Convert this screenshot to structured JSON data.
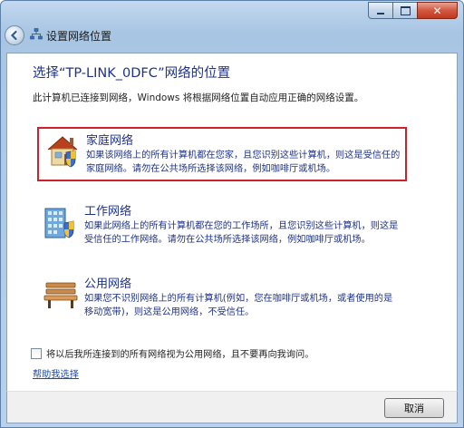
{
  "window": {
    "title": "设置网络位置",
    "close_glyph": "✕"
  },
  "content": {
    "heading": "选择“TP-LINK_0DFC”网络的位置",
    "description": "此计算机已连接到网络，Windows 将根据网络位置自动应用正确的网络设置。",
    "options": [
      {
        "title": "家庭网络",
        "desc": "如果该网络上的所有计算机都在您家，且您识别这些计算机，则这是受信任的家庭网络。请勿在公共场所选择该网络，例如咖啡厅或机场。",
        "icon": "home-icon",
        "selected": true
      },
      {
        "title": "工作网络",
        "desc": "如果此网络上的所有计算机都在您的工作场所，且您识别这些计算机，则这是受信任的工作网络。请勿在公共场所选择该网络，例如咖啡厅或机场。",
        "icon": "office-building-icon",
        "selected": false
      },
      {
        "title": "公用网络",
        "desc": "如果您不识别网络上的所有计算机(例如，您在咖啡厅或机场，或者使用的是移动宽带)，则这是公用网络，不受信任。",
        "icon": "park-bench-icon",
        "selected": false
      }
    ],
    "checkbox_label": "将以后我所连接到的所有网络视为公用网络，且不要再向我询问。",
    "checkbox_checked": false,
    "help_link": "帮助我选择"
  },
  "footer": {
    "cancel_label": "取消"
  },
  "colors": {
    "heading": "#1e3287",
    "selection_border": "#d0202a",
    "link": "#1e4ca4"
  }
}
